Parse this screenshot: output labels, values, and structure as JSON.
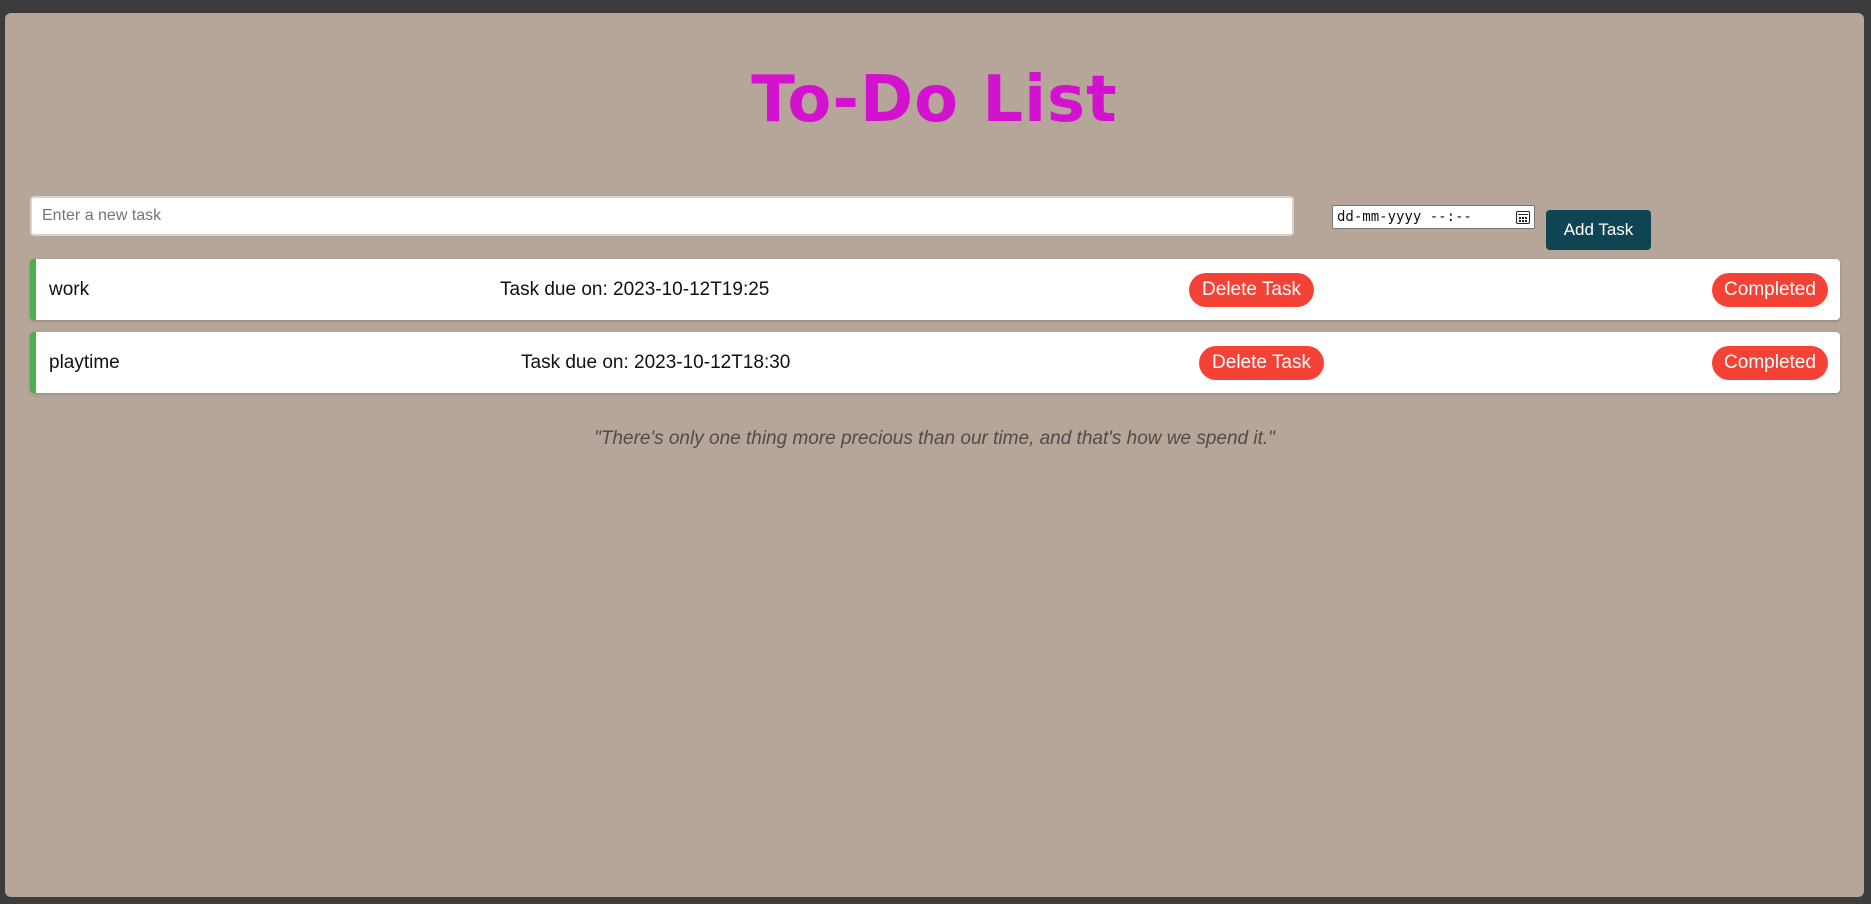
{
  "app": {
    "title": "To-Do List"
  },
  "form": {
    "task_placeholder": "Enter a new task",
    "task_value": "",
    "datetime_placeholder": "dd-mm-yyyy --:--",
    "add_label": "Add Task"
  },
  "tasks": [
    {
      "name": "work",
      "due": "Task due on: 2023-10-12T19:25",
      "delete_label": "Delete Task",
      "complete_label": "Completed"
    },
    {
      "name": "playtime",
      "due": "Task due on: 2023-10-12T18:30",
      "delete_label": "Delete Task",
      "complete_label": "Completed"
    }
  ],
  "quote": "\"There's only one thing more precious than our time, and that's how we spend it.\"",
  "colors": {
    "title": "#d312cf",
    "background": "#b6a699",
    "add_button": "#0f4452",
    "action_button": "#f44336",
    "task_accent": "#4caf50"
  },
  "icons": {
    "date_picker": "calendar-icon"
  }
}
